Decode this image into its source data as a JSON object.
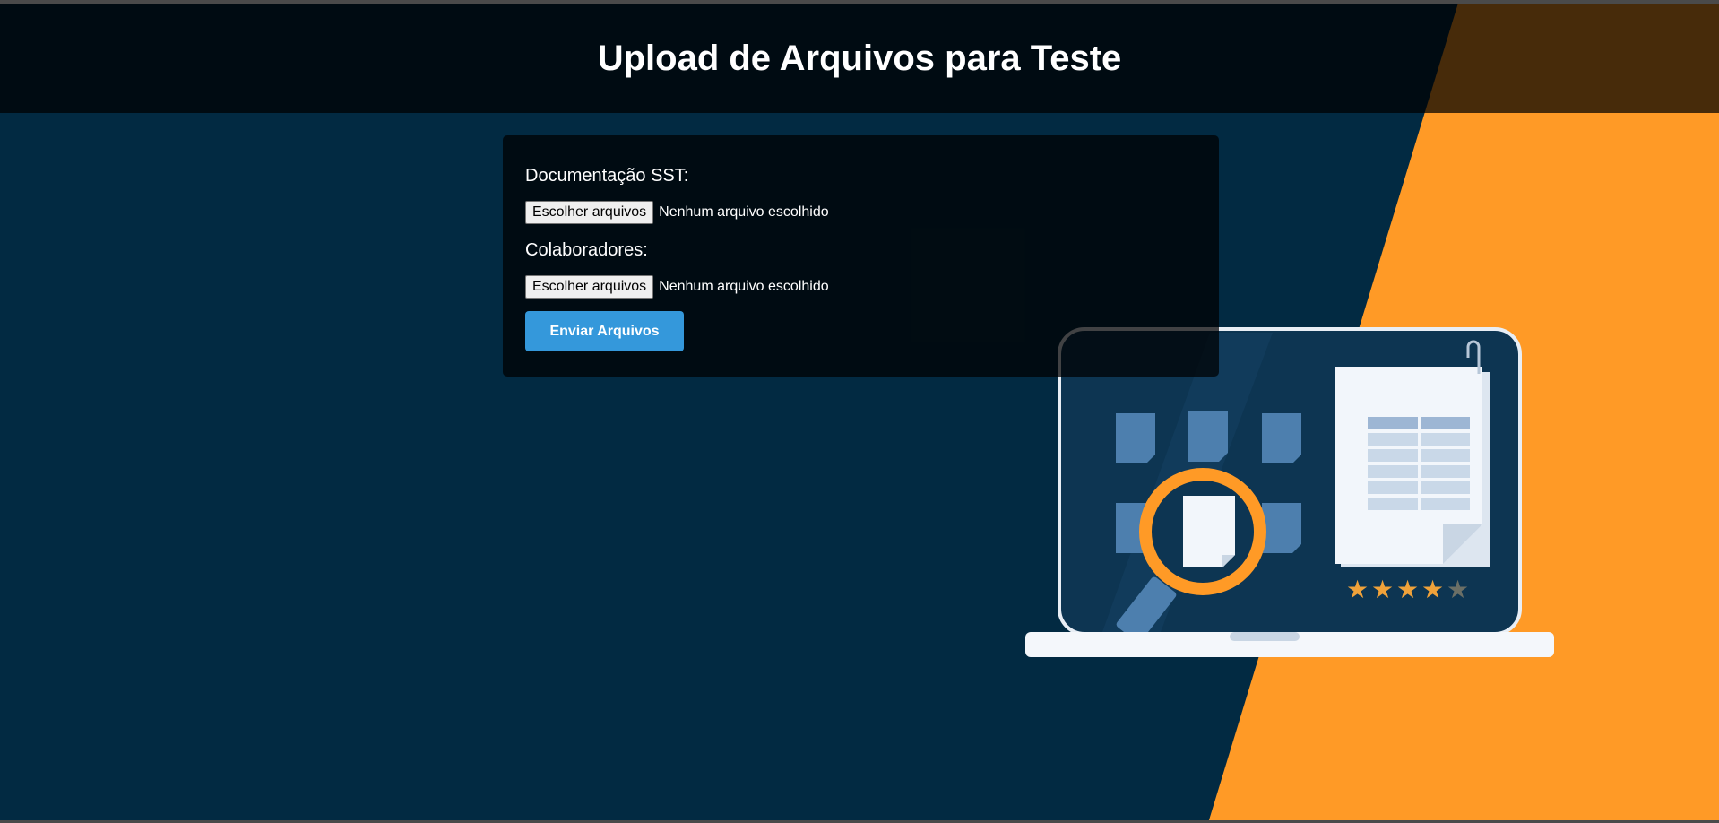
{
  "header": {
    "title": "Upload de Arquivos para Teste"
  },
  "form": {
    "fields": [
      {
        "label": "Documentação SST:",
        "button_label": "Escolher arquivos",
        "status": "Nenhum arquivo escolhido"
      },
      {
        "label": "Colaboradores:",
        "button_label": "Escolher arquivos",
        "status": "Nenhum arquivo escolhido"
      }
    ],
    "submit_label": "Enviar Arquivos"
  },
  "illustration": {
    "rating_stars": 4,
    "rating_max": 5
  },
  "colors": {
    "background": "#022a42",
    "accent_orange": "#ff9a26",
    "button_blue": "#3498db",
    "overlay": "rgba(0,0,0,0.72)"
  }
}
